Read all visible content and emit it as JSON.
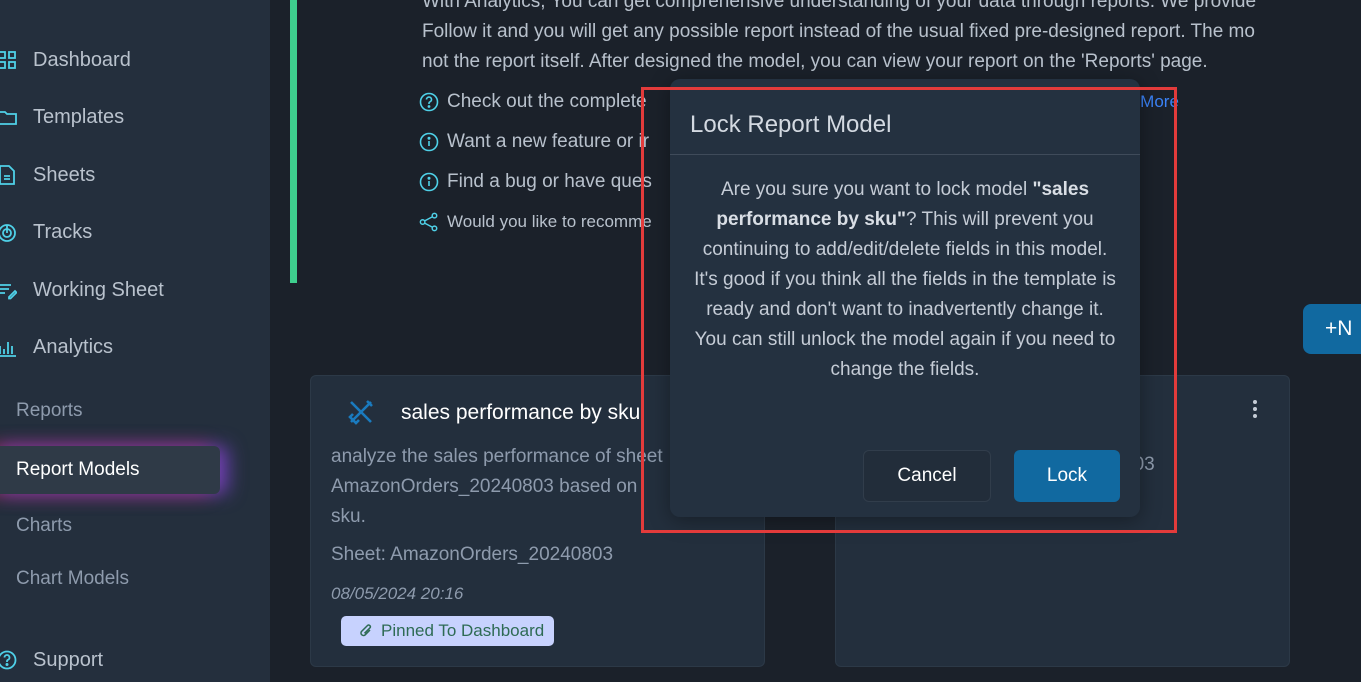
{
  "sidebar": {
    "items": [
      {
        "label": "Dashboard",
        "icon": "dashboard-grid-icon"
      },
      {
        "label": "Templates",
        "icon": "folder-icon"
      },
      {
        "label": "Sheets",
        "icon": "document-icon"
      },
      {
        "label": "Tracks",
        "icon": "target-icon"
      },
      {
        "label": "Working Sheet",
        "icon": "list-edit-icon"
      },
      {
        "label": "Analytics",
        "icon": "bar-chart-icon"
      }
    ],
    "analytics_subitems": [
      {
        "label": "Reports"
      },
      {
        "label": "Report Models",
        "active": true
      },
      {
        "label": "Charts"
      },
      {
        "label": "Chart Models"
      }
    ],
    "support": {
      "label": "Support",
      "icon": "question-circle-icon"
    }
  },
  "intro": {
    "lines": [
      "With Analytics, You can get comprehensive understanding of your data through reports. We provide",
      "Follow it and you will get any possible report instead of the usual fixed pre-designed report. The mo",
      "not the report itself. After designed the model, you can view your report on the 'Reports' page."
    ],
    "help_rows": [
      {
        "text": "Check out the complete",
        "icon": "question-circle-icon"
      },
      {
        "text": "Want a new feature or ir",
        "icon": "info-circle-icon"
      },
      {
        "text": "Find a bug or have ques",
        "icon": "info-circle-icon"
      },
      {
        "text": "Would you like to recomme",
        "icon": "share-icon"
      }
    ],
    "learn_more": "n More"
  },
  "toolbar": {
    "new_button": "+N"
  },
  "cards": [
    {
      "title": "sales performance by sku",
      "description": "analyze the sales performance of sheet AmazonOrders_20240803 based on sku.",
      "sheet": "Sheet: AmazonOrders_20240803",
      "date": "08/05/2024 20:16",
      "badge": "Pinned To Dashboard"
    },
    {
      "sheet_fragment": "303"
    }
  ],
  "modal": {
    "title": "Lock Report Model",
    "body_prefix": "Are you sure you want to lock model ",
    "body_model": "\"sales performance by sku\"",
    "body_suffix": "? This will prevent you continuing to add/edit/delete fields in this model. It's good if you think all the fields in the template is ready and don't want to inadvertently change it. You can still unlock the model again if you need to change the fields.",
    "cancel_label": "Cancel",
    "confirm_label": "Lock"
  },
  "colors": {
    "accent": "#1169a0",
    "intro_bar": "#3ecf8e",
    "link": "#3b82f6",
    "icon_cyan": "#4fd1e8",
    "highlight": "#e33b3b"
  }
}
